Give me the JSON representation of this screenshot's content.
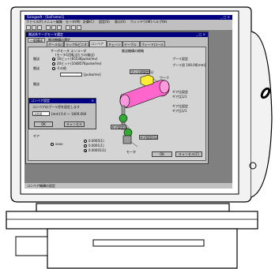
{
  "app": {
    "title": "Sizingsoft - [SizFrame1]",
    "window_controls": "_ □ ×"
  },
  "menu": [
    "ファイル(F)",
    "メニュー編集",
    "モータ(M)",
    "計算(C)",
    "設定(S)",
    "表示(V)",
    "ウィンドウ(W)",
    "ヘルプ(H)"
  ],
  "child_window": {
    "title": "搬送系サーボモータ選定",
    "controls": "_ □ ×"
  },
  "side_tab": "一般構成",
  "section_heading": "搬送機構の選定",
  "tabs": [
    "ボールねじ",
    "ラック&ピニオン",
    "コンベア",
    "チェーン",
    "テーブル",
    "フィードロール"
  ],
  "left_panel": {
    "labels": [
      "搬送",
      "搬送",
      "搬送",
      "オン",
      "ギア"
    ],
    "encoder_title": "サーボモータ エンコーダ",
    "encoder_sub": "(モータ1回転当たりの検出)",
    "options": [
      "16ビット(65536pulse/rev)",
      "20ビット(1048576pulse/rev)",
      "その他"
    ],
    "pulse_unit": "[pulse/rev]",
    "bottom_opts": [
      "xxxx",
      "0.0005(1)",
      "0.0001(1)",
      "0.00001(1)"
    ]
  },
  "popup": {
    "title": "コンベア設定",
    "message": "コンベアのプーリ径を設定します",
    "value": "1000",
    "unit_hint": "[mm] 0.0 ～ 1000.000",
    "ok": "OK",
    "cancel": "キャンセル"
  },
  "diagram": {
    "title": "搬送機構の概略",
    "button_top": "プーリ径設定(L)",
    "label_work": "ワーク",
    "button_mid": "ギア設定(S)",
    "button_low": "ギア設定(G)",
    "label_motor": "モータ"
  },
  "right_panel": {
    "pulley_label": "プーリ設定",
    "pulley_value": "プーリ径 100.00[mm]",
    "gear_label": "ギア比設定",
    "gear_value": "ギア比1/1",
    "gear2_label": "ギア比設定",
    "gear2_value": "ギア比1/1"
  },
  "footer_buttons": {
    "ok": "OK",
    "cancel": "キャンセル(C)"
  },
  "status": "コンベア機構の設定",
  "colors": {
    "title_blue": "#000080",
    "pink_belt": "#ff66cc",
    "green_pulley": "#33aa33",
    "yellow_work": "#ffee33"
  }
}
